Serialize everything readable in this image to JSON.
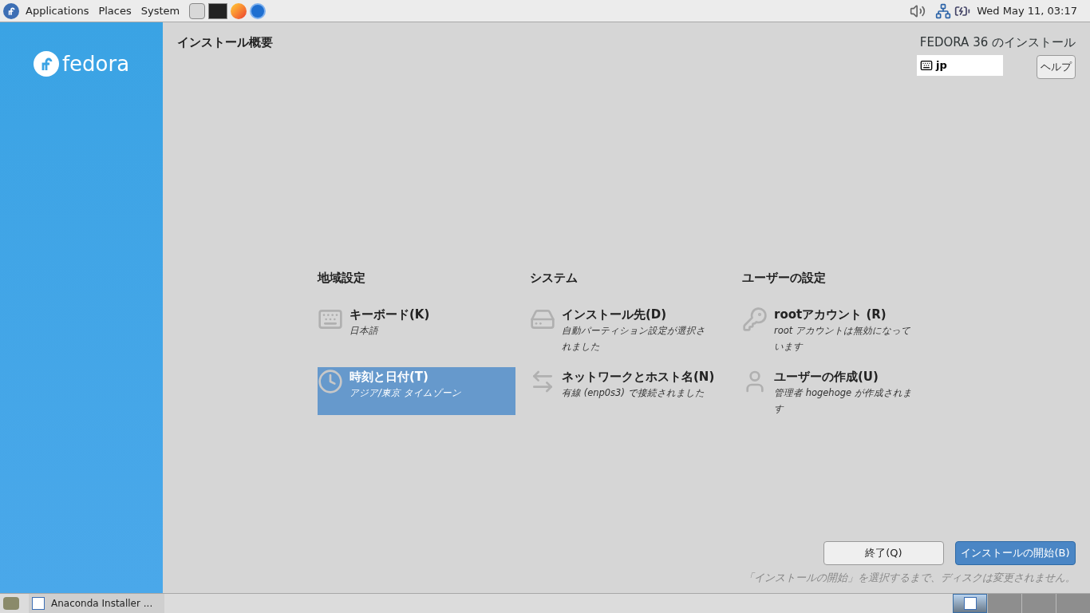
{
  "top_panel": {
    "menus": [
      {
        "label": "Applications"
      },
      {
        "label": "Places"
      },
      {
        "label": "System"
      }
    ],
    "clock": "Wed May 11, 03:17"
  },
  "sidebar": {
    "logo_text": "fedora"
  },
  "header": {
    "title": "インストール概要",
    "product": "FEDORA 36 のインストール",
    "keyboard_layout": "jp",
    "help_button": "ヘルプ"
  },
  "sections": [
    {
      "title": "地域設定",
      "spokes": [
        {
          "kind": "keyboard",
          "title": "キーボード(K)",
          "status": "日本語",
          "selected": false
        },
        {
          "kind": "time",
          "title": "時刻と日付(T)",
          "status": "アジア/東京 タイムゾーン",
          "selected": true
        }
      ]
    },
    {
      "title": "システム",
      "spokes": [
        {
          "kind": "disk",
          "title": "インストール先(D)",
          "status": "自動パーティション設定が選択されました",
          "selected": false
        },
        {
          "kind": "network",
          "title": "ネットワークとホスト名(N)",
          "status": "有線 (enp0s3) で接続されました",
          "selected": false
        }
      ]
    },
    {
      "title": "ユーザーの設定",
      "spokes": [
        {
          "kind": "root",
          "title": "rootアカウント (R)",
          "status": "root アカウントは無効になっています",
          "selected": false
        },
        {
          "kind": "user",
          "title": "ユーザーの作成(U)",
          "status": "管理者 hogehoge が作成されます",
          "selected": false
        }
      ]
    }
  ],
  "footer": {
    "quit_button": "終了(Q)",
    "begin_button": "インストールの開始(B)",
    "note": "「インストールの開始」を選択するまで、ディスクは変更されません。"
  },
  "taskbar": {
    "task": "Anaconda Installer ...",
    "workspaces": [
      {
        "selected": true,
        "has_window": true
      },
      {
        "selected": false,
        "has_window": false
      },
      {
        "selected": false,
        "has_window": false
      },
      {
        "selected": false,
        "has_window": false
      }
    ]
  }
}
